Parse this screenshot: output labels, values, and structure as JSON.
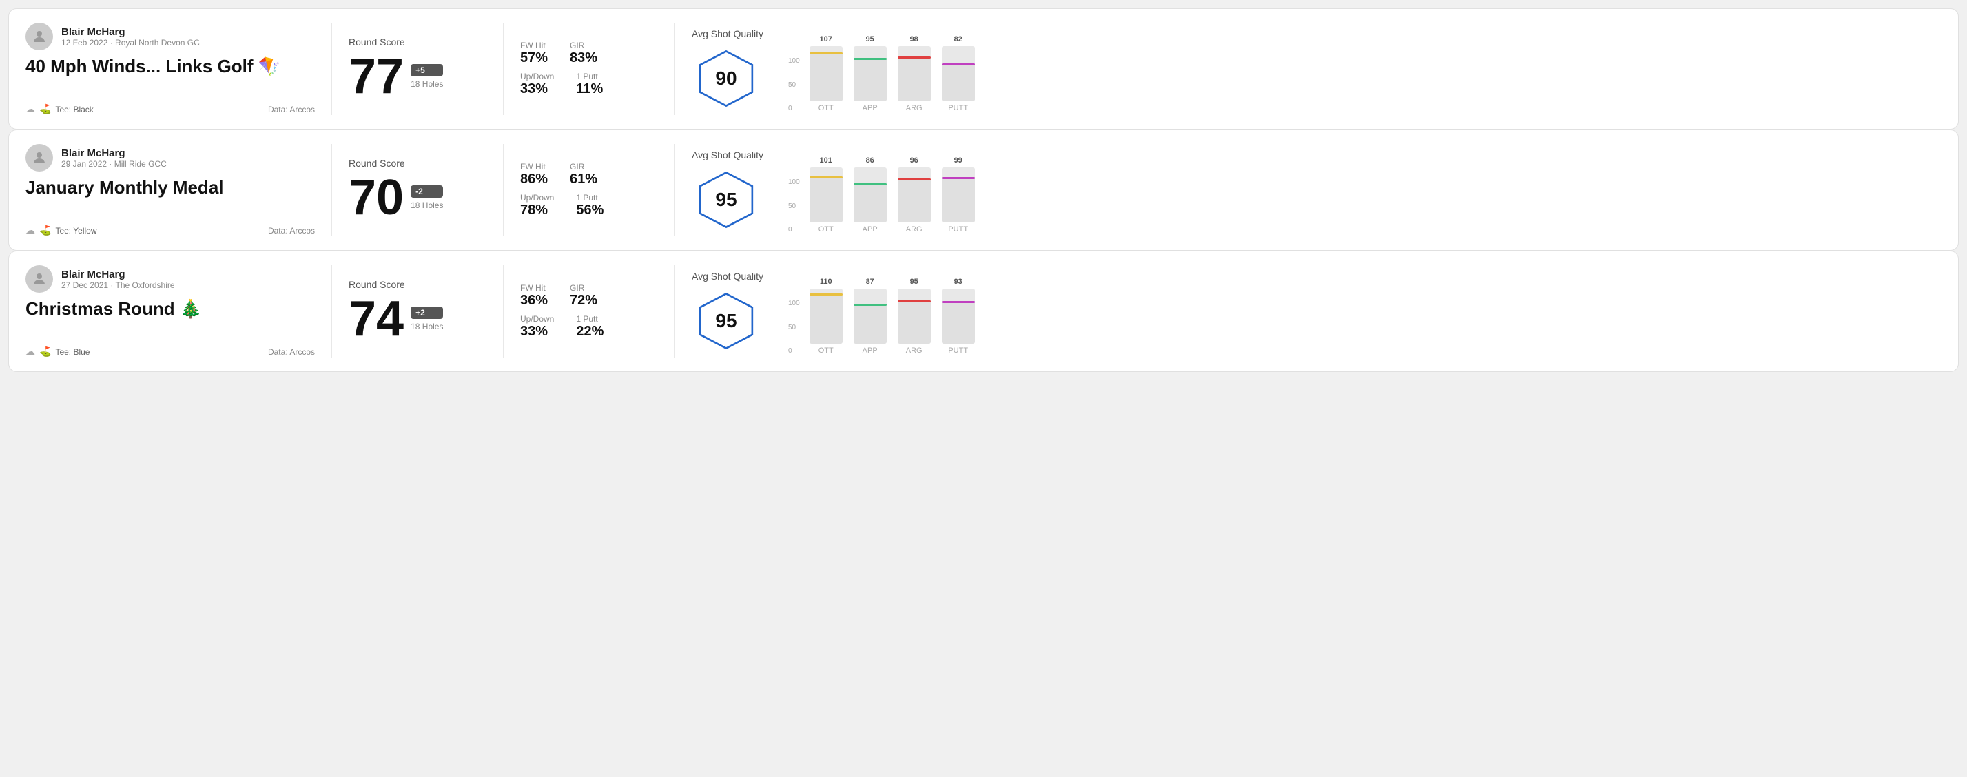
{
  "rounds": [
    {
      "player": "Blair McHarg",
      "date": "12 Feb 2022 · Royal North Devon GC",
      "title": "40 Mph Winds... Links Golf 🪁",
      "tee": "Black",
      "data_source": "Data: Arccos",
      "score_label": "Round Score",
      "score": "77",
      "score_diff": "+5",
      "holes": "18 Holes",
      "fw_hit": "57%",
      "gir": "83%",
      "up_down": "33%",
      "one_putt": "11%",
      "quality_label": "Avg Shot Quality",
      "quality_score": "90",
      "bars": [
        {
          "label": "OTT",
          "value": 107,
          "color": "#e8c040"
        },
        {
          "label": "APP",
          "value": 95,
          "color": "#40c080"
        },
        {
          "label": "ARG",
          "value": 98,
          "color": "#e04040"
        },
        {
          "label": "PUTT",
          "value": 82,
          "color": "#c040c0"
        }
      ]
    },
    {
      "player": "Blair McHarg",
      "date": "29 Jan 2022 · Mill Ride GCC",
      "title": "January Monthly Medal",
      "tee": "Yellow",
      "data_source": "Data: Arccos",
      "score_label": "Round Score",
      "score": "70",
      "score_diff": "-2",
      "holes": "18 Holes",
      "fw_hit": "86%",
      "gir": "61%",
      "up_down": "78%",
      "one_putt": "56%",
      "quality_label": "Avg Shot Quality",
      "quality_score": "95",
      "bars": [
        {
          "label": "OTT",
          "value": 101,
          "color": "#e8c040"
        },
        {
          "label": "APP",
          "value": 86,
          "color": "#40c080"
        },
        {
          "label": "ARG",
          "value": 96,
          "color": "#e04040"
        },
        {
          "label": "PUTT",
          "value": 99,
          "color": "#c040c0"
        }
      ]
    },
    {
      "player": "Blair McHarg",
      "date": "27 Dec 2021 · The Oxfordshire",
      "title": "Christmas Round 🎄",
      "tee": "Blue",
      "data_source": "Data: Arccos",
      "score_label": "Round Score",
      "score": "74",
      "score_diff": "+2",
      "holes": "18 Holes",
      "fw_hit": "36%",
      "gir": "72%",
      "up_down": "33%",
      "one_putt": "22%",
      "quality_label": "Avg Shot Quality",
      "quality_score": "95",
      "bars": [
        {
          "label": "OTT",
          "value": 110,
          "color": "#e8c040"
        },
        {
          "label": "APP",
          "value": 87,
          "color": "#40c080"
        },
        {
          "label": "ARG",
          "value": 95,
          "color": "#e04040"
        },
        {
          "label": "PUTT",
          "value": 93,
          "color": "#c040c0"
        }
      ]
    }
  ],
  "labels": {
    "fw_hit": "FW Hit",
    "gir": "GIR",
    "up_down": "Up/Down",
    "one_putt": "1 Putt",
    "tee_prefix": "Tee:",
    "chart_scale_100": "100",
    "chart_scale_50": "50",
    "chart_scale_0": "0"
  }
}
